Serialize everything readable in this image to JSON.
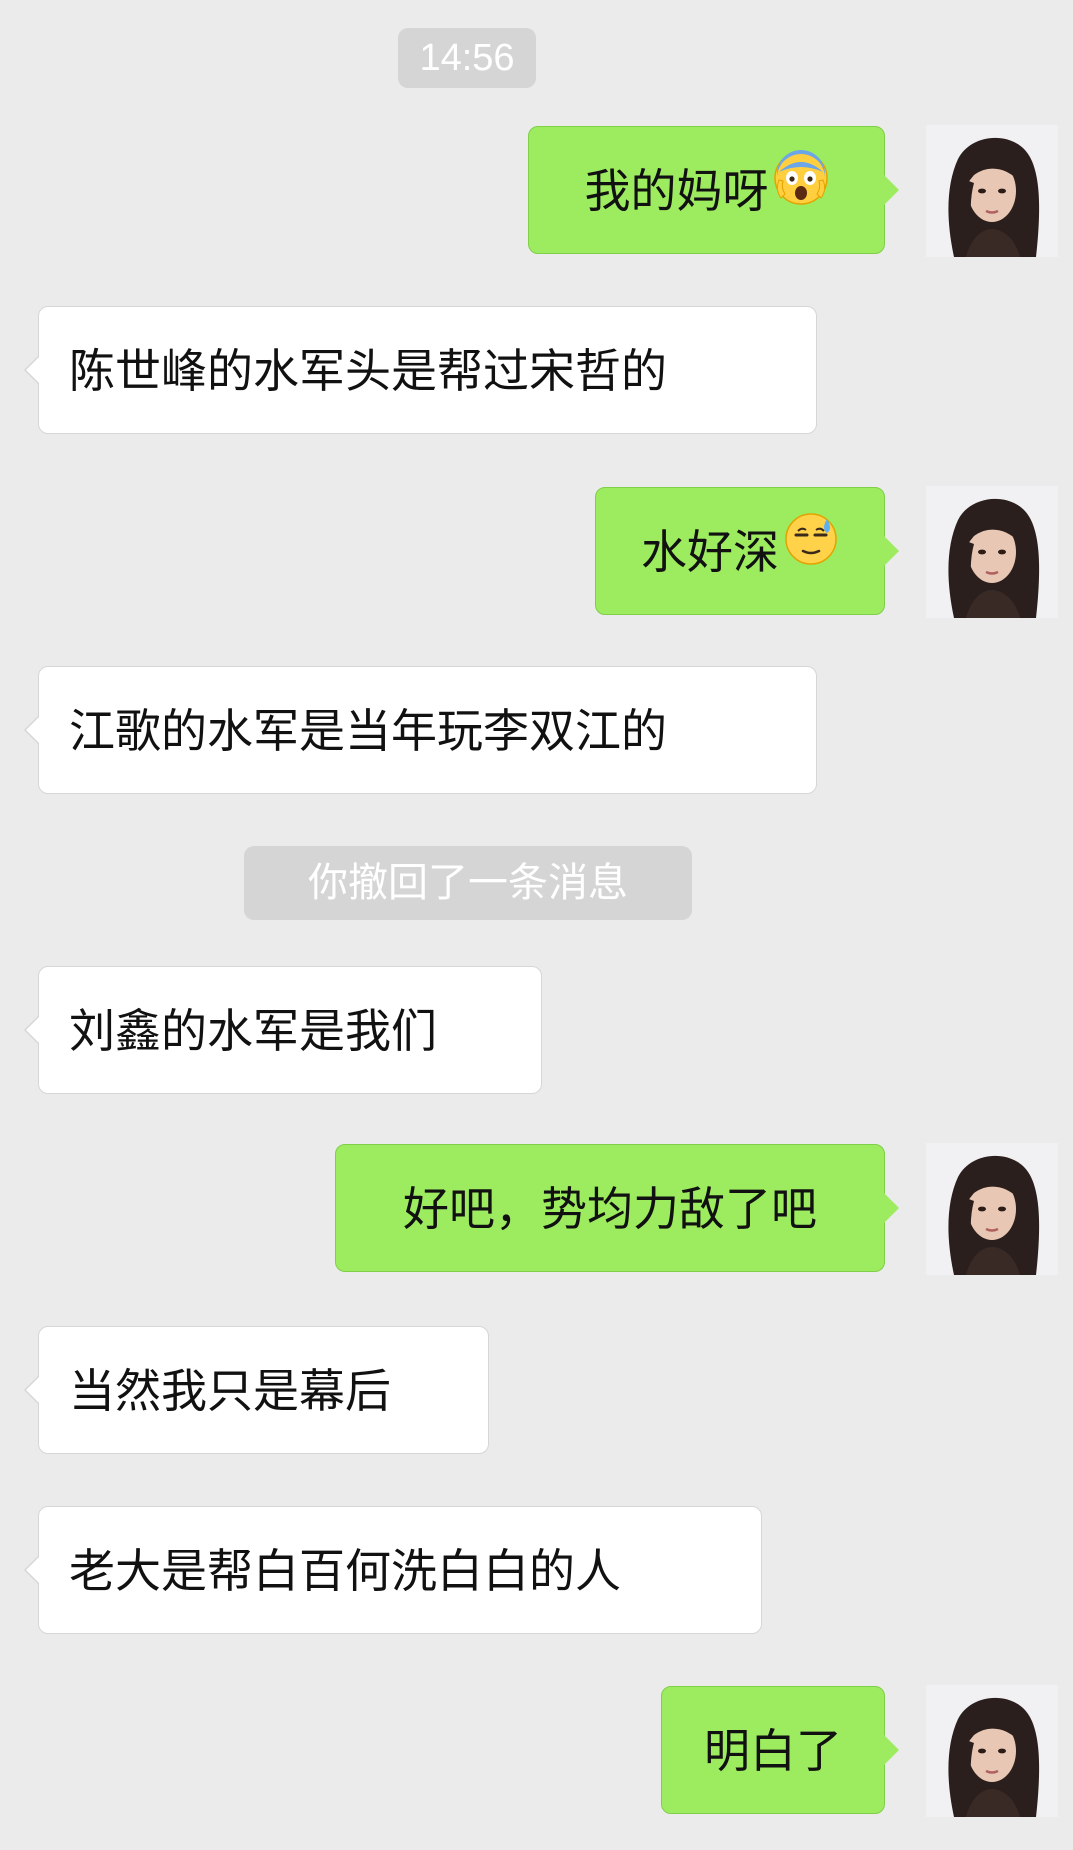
{
  "chat": {
    "time_label": "14:56",
    "recall_notice": "你撤回了一条消息",
    "messages": [
      {
        "side": "out",
        "text": "我的妈呀",
        "emoji": "fearful-face-icon"
      },
      {
        "side": "in",
        "text": "陈世峰的水军头是帮过宋哲的"
      },
      {
        "side": "out",
        "text": "水好深",
        "emoji": "sweat-face-icon"
      },
      {
        "side": "in",
        "text": "江歌的水军是当年玩李双江的"
      },
      {
        "side": "in",
        "text": "刘鑫的水军是我们"
      },
      {
        "side": "out",
        "text": "好吧，势均力敌了吧"
      },
      {
        "side": "in",
        "text": "当然我只是幕后"
      },
      {
        "side": "in",
        "text": "老大是帮白百何洗白白的人"
      },
      {
        "side": "out",
        "text": "明白了"
      }
    ]
  },
  "colors": {
    "background": "#ebebeb",
    "outgoing_bubble": "#9deb5f",
    "incoming_bubble": "#ffffff",
    "system_pill": "#d5d5d5"
  }
}
